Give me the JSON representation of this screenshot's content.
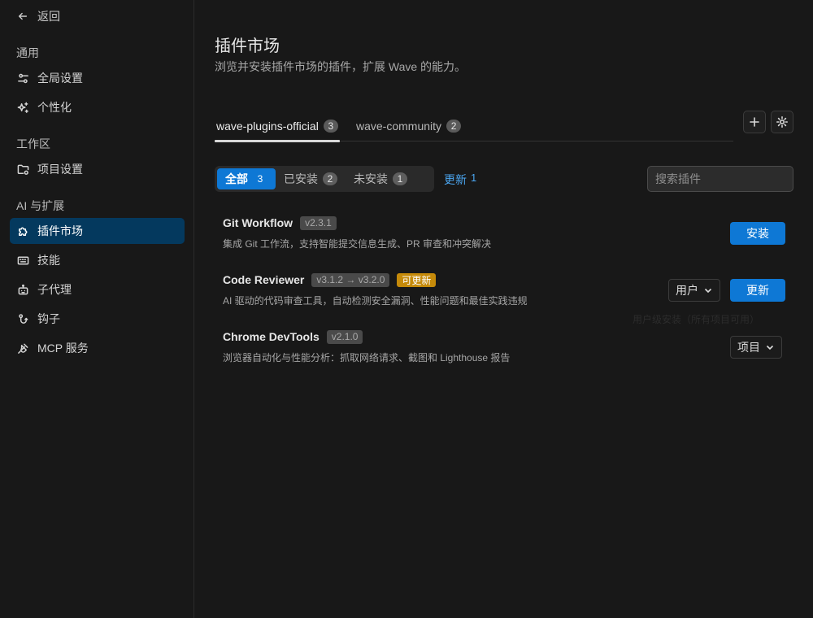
{
  "sidebar": {
    "back_label": "返回",
    "sections": {
      "general": "通用",
      "workspace": "工作区",
      "ai": "AI 与扩展"
    },
    "items": {
      "global": {
        "label": "全局设置",
        "icon": "sliders-icon"
      },
      "personalize": {
        "label": "个性化",
        "icon": "sparkle-icon"
      },
      "project": {
        "label": "项目设置",
        "icon": "folder-gear-icon"
      },
      "marketplace": {
        "label": "插件市场",
        "icon": "puzzle-icon",
        "active": true
      },
      "skills": {
        "label": "技能",
        "icon": "keyboard-icon"
      },
      "subagent": {
        "label": "子代理",
        "icon": "robot-icon"
      },
      "hooks": {
        "label": "钩子",
        "icon": "hook-icon"
      },
      "mcp": {
        "label": "MCP 服务",
        "icon": "plug-icon"
      }
    }
  },
  "header": {
    "title": "插件市场",
    "subtitle": "浏览并安装插件市场的插件，扩展 Wave 的能力。"
  },
  "sources": {
    "tabs": [
      {
        "label": "wave-plugins-official",
        "count": "3",
        "active": true
      },
      {
        "label": "wave-community",
        "count": "2",
        "active": false
      }
    ],
    "add_icon": "plus-icon",
    "settings_icon": "gear-icon"
  },
  "filters": {
    "all": {
      "label": "全部",
      "count": "3"
    },
    "installed": {
      "label": "已安装",
      "count": "2"
    },
    "not_installed": {
      "label": "未安装",
      "count": "1"
    },
    "updates": {
      "label": "更新",
      "count": "1"
    }
  },
  "search": {
    "placeholder": "搜索插件",
    "value": ""
  },
  "plugins": [
    {
      "name": "Git Workflow",
      "version": "v2.3.1",
      "description": "集成 Git 工作流，支持智能提交信息生成、PR 审查和冲突解决",
      "action": "安装"
    },
    {
      "name": "Code Reviewer",
      "version": "v3.1.2 → v3.2.0",
      "update_badge": "可更新",
      "description": "AI 驱动的代码审查工具，自动检测安全漏洞、性能问题和最佳实践违规",
      "scope": "用户",
      "action": "更新",
      "tooltip": "用户级安装（所有项目可用）"
    },
    {
      "name": "Chrome DevTools",
      "version": "v2.1.0",
      "description": "浏览器自动化与性能分析：抓取网络请求、截图和 Lighthouse 报告",
      "scope": "项目"
    }
  ],
  "colors": {
    "accent": "#0e78d5",
    "active_nav": "#04395e",
    "update_badge": "#c58a0a",
    "link": "#4ba6f1"
  }
}
